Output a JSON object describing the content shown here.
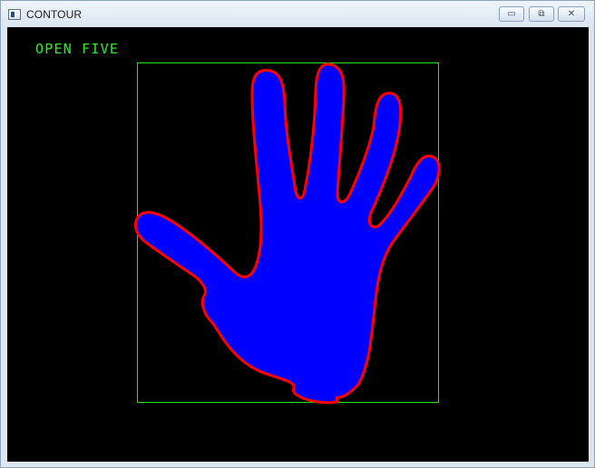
{
  "window": {
    "title": "CONTOUR",
    "icon": "app-window-icon",
    "controls": {
      "minimize_icon": "minimize-icon",
      "maximize_icon": "maximize-icon",
      "close_icon": "close-icon",
      "minimize_glyph": "▭",
      "maximize_glyph": "⧉",
      "close_glyph": "✕"
    }
  },
  "canvas": {
    "background": "#000000",
    "overlay_text": "OPEN FIVE",
    "overlay_color": "#28ef28",
    "bounding_box_color": "#26e626",
    "hand_fill": "#0000ff",
    "contour_color": "#ff0000"
  }
}
